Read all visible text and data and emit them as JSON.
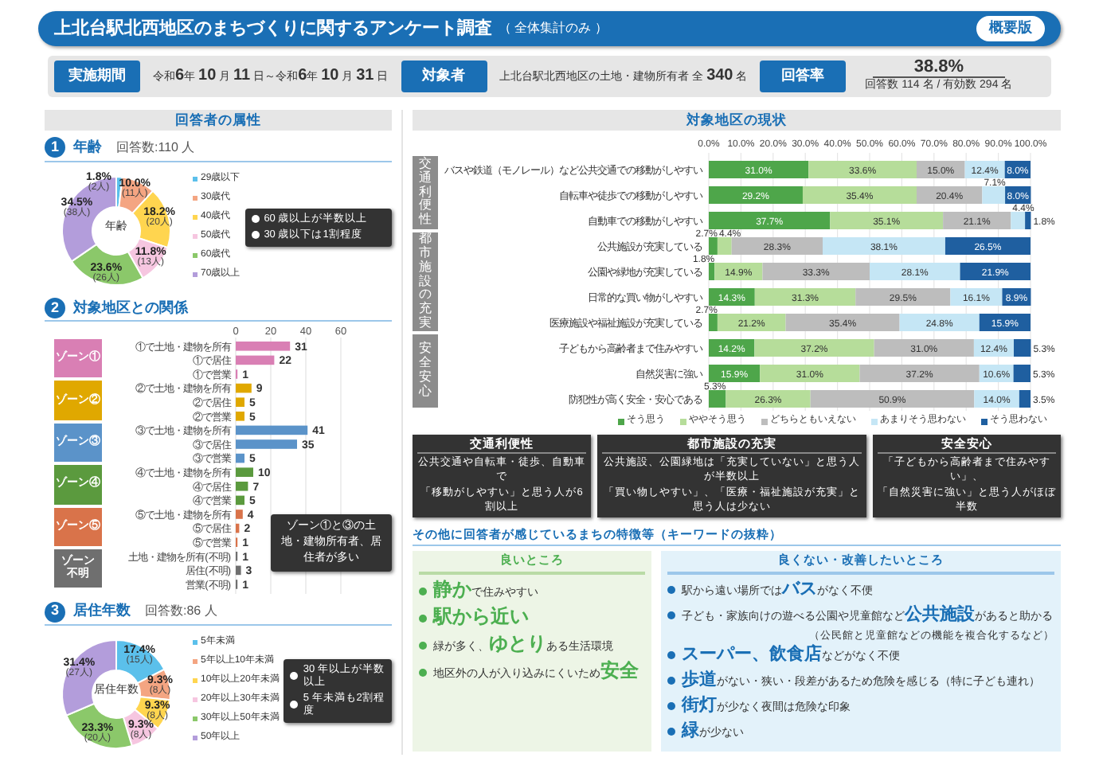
{
  "header": {
    "title": "上北台駅北西地区のまちづくりに関するアンケート調査",
    "subtitle": "（ 全体集計のみ ）",
    "badge": "概要版"
  },
  "info": {
    "period_label": "実施期間",
    "period": "令和**6**年 **10** 月 **11** 日～令和**6**年 **10** 月 **31** 日",
    "target_label": "対象者",
    "target": "上北台駅北西地区の土地・建物所有者 全 **340** 名",
    "rate_label": "回答率",
    "rate": "38.8%",
    "rate_detail": "回答数 114 名 / 有効数 294 名"
  },
  "attributes": {
    "title": "回答者の属性",
    "age": {
      "number": "1",
      "title": "年齢",
      "count": "回答数:110 人",
      "center": "年齢",
      "notes": [
        "60 歳以上が半数以上",
        "30 歳以下は1割程度"
      ],
      "chart_data": {
        "type": "donut",
        "categories": [
          "29歳以下",
          "30歳代",
          "40歳代",
          "50歳代",
          "60歳代",
          "70歳以上"
        ],
        "values": [
          1.8,
          10.0,
          18.2,
          11.8,
          23.6,
          34.5
        ],
        "value_labels": [
          "1.8%",
          "10.0%",
          "18.2%",
          "11.8%",
          "23.6%",
          "34.5%"
        ],
        "annotations": [
          "(2人)",
          "(11人)",
          "(20人)",
          "(13人)",
          "(26人)",
          "(38人)"
        ],
        "colors": [
          "#5bc0eb",
          "#f4a582",
          "#ffd54f",
          "#f6c6e0",
          "#8bc86a",
          "#b39ddb"
        ]
      }
    },
    "relation": {
      "number": "2",
      "title": "対象地区との関係",
      "note": "ゾーン①と③の土地・建物所有者、居住者が多い",
      "zones": [
        {
          "lines": [
            "ゾーン①"
          ],
          "color": "#d97fb4"
        },
        {
          "lines": [
            "ゾーン②"
          ],
          "color": "#e0a800"
        },
        {
          "lines": [
            "ゾーン③"
          ],
          "color": "#5b93c9"
        },
        {
          "lines": [
            "ゾーン④"
          ],
          "color": "#5b9a3e"
        },
        {
          "lines": [
            "ゾーン⑤"
          ],
          "color": "#d9734a"
        },
        {
          "lines": [
            "ゾーン",
            "不明"
          ],
          "color": "#6f6f6f"
        }
      ],
      "chart_data": {
        "type": "bar",
        "orientation": "horizontal",
        "xlim": [
          0,
          60
        ],
        "xticks": [
          0,
          20,
          40,
          60
        ],
        "grid": true,
        "data_labels": true,
        "categories": [
          "①で土地・建物を所有",
          "①で居住",
          "①で営業",
          "②で土地・建物を所有",
          "②で居住",
          "②で営業",
          "③で土地・建物を所有",
          "③で居住",
          "③で営業",
          "④で土地・建物を所有",
          "④で居住",
          "④で営業",
          "⑤で土地・建物を所有",
          "⑤で居住",
          "⑤で営業",
          "土地・建物を所有(不明)",
          "居住(不明)",
          "営業(不明)"
        ],
        "values": [
          31,
          22,
          1,
          9,
          5,
          5,
          41,
          35,
          5,
          10,
          7,
          5,
          4,
          2,
          1,
          1,
          3,
          1
        ]
      }
    },
    "residence": {
      "number": "3",
      "title": "居住年数",
      "count": "回答数:86 人",
      "center": "居住年数",
      "notes": [
        "30 年以上が半数以上",
        "5 年未満も2割程度"
      ],
      "chart_data": {
        "type": "donut",
        "categories": [
          "5年未満",
          "5年以上10年未満",
          "10年以上20年未満",
          "20年以上30年未満",
          "30年以上50年未満",
          "50年以上"
        ],
        "values": [
          17.4,
          9.3,
          9.3,
          9.3,
          23.3,
          31.4
        ],
        "value_labels": [
          "17.4%",
          "9.3%",
          "9.3%",
          "9.3%",
          "23.3%",
          "31.4%"
        ],
        "annotations": [
          "(15人)",
          "(8人)",
          "(8人)",
          "(8人)",
          "(20人)",
          "(27人)"
        ],
        "colors": [
          "#5bc0eb",
          "#f4a582",
          "#ffd54f",
          "#f6c6e0",
          "#8bc86a",
          "#b39ddb"
        ]
      }
    }
  },
  "status": {
    "title": "対象地区の現状",
    "groups": [
      {
        "label": "交通利便性",
        "categories": [
          "バスや鉄道（モノレール）など公共交通での移動がしやすい",
          "自転車や徒歩での移動がしやすい",
          "自動車での移動がしやすい"
        ]
      },
      {
        "label": "都市施設の充実",
        "categories": [
          "公共施設が充実している",
          "公園や緑地が充実している",
          "日常的な買い物がしやすい",
          "医療施設や福祉施設が充実している"
        ]
      },
      {
        "label": "安全安心",
        "categories": [
          "子どもから高齢者まで住みやすい",
          "自然災害に強い",
          "防犯性が高く安全・安心である"
        ]
      }
    ],
    "chart_data": {
      "type": "bar",
      "orientation": "horizontal",
      "stacked": true,
      "grid": true,
      "xlim": [
        0,
        100
      ],
      "xticks": [
        {
          "value": 0,
          "label": "0.0%"
        },
        {
          "value": 10,
          "label": "10.0%"
        },
        {
          "value": 20,
          "label": "20.0%"
        },
        {
          "value": 30,
          "label": "30.0%"
        },
        {
          "value": 40,
          "label": "40.0%"
        },
        {
          "value": 50,
          "label": "50.0%"
        },
        {
          "value": 60,
          "label": "60.0%"
        },
        {
          "value": 70,
          "label": "70.0%"
        },
        {
          "value": 80,
          "label": "80.0%"
        },
        {
          "value": 90,
          "label": "90.0%"
        },
        {
          "value": 100,
          "label": "100.0%"
        }
      ],
      "series": [
        {
          "name": "そう思う",
          "color": "#4ea64a",
          "values": [
            31.0,
            29.2,
            37.7,
            2.7,
            1.8,
            14.3,
            2.7,
            14.2,
            15.9,
            5.3
          ]
        },
        {
          "name": "ややそう思う",
          "color": "#b6dd9a",
          "values": [
            33.6,
            35.4,
            35.1,
            4.4,
            14.9,
            31.3,
            21.2,
            37.2,
            31.0,
            26.3
          ]
        },
        {
          "name": "どちらともいえない",
          "color": "#bdbdbd",
          "values": [
            15.0,
            20.4,
            21.1,
            28.3,
            33.3,
            29.5,
            35.4,
            31.0,
            37.2,
            50.9
          ]
        },
        {
          "name": "あまりそう思わない",
          "color": "#c5e6f5",
          "values": [
            12.4,
            7.1,
            4.4,
            38.1,
            28.1,
            16.1,
            24.8,
            12.4,
            10.6,
            14.0
          ]
        },
        {
          "name": "そう思わない",
          "color": "#1f5fa0",
          "values": [
            8.0,
            8.0,
            1.8,
            26.5,
            21.9,
            8.9,
            15.9,
            5.3,
            5.3,
            3.5
          ]
        }
      ],
      "value_labels": [
        [
          "31.0%",
          "29.2%",
          "37.7%",
          "2.7%",
          "1.8%",
          "14.3%",
          "2.7%",
          "14.2%",
          "15.9%",
          "5.3%"
        ],
        [
          "33.6%",
          "35.4%",
          "35.1%",
          "4.4%",
          "14.9%",
          "31.3%",
          "21.2%",
          "37.2%",
          "31.0%",
          "26.3%"
        ],
        [
          "15.0%",
          "20.4%",
          "21.1%",
          "28.3%",
          "33.3%",
          "29.5%",
          "35.4%",
          "31.0%",
          "37.2%",
          "50.9%"
        ],
        [
          "12.4%",
          "7.1%",
          "4.4%",
          "38.1%",
          "28.1%",
          "16.1%",
          "24.8%",
          "12.4%",
          "10.6%",
          "14.0%"
        ],
        [
          "8.0%",
          "8.0%",
          "1.8%",
          "26.5%",
          "21.9%",
          "8.9%",
          "15.9%",
          "5.3%",
          "5.3%",
          "3.5%"
        ]
      ]
    },
    "summaries": [
      {
        "title": "交通利便性",
        "lines": [
          "公共交通や自転車・徒歩、自動車で",
          "「移動がしやすい」と思う人が6割以上"
        ]
      },
      {
        "title": "都市施設の充実",
        "lines": [
          "公共施設、公園緑地は「充実していない」と思う人が半数以上",
          "「買い物しやすい」、「医療・福祉施設が充実」と思う人は少ない"
        ]
      },
      {
        "title": "安全安心",
        "lines": [
          "「子どもから高齢者まで住みやすい」、",
          "「自然災害に強い」と思う人がほぼ半数"
        ]
      }
    ]
  },
  "keywords": {
    "title": "その他に回答者が感じているまちの特徴等（キーワードの抜粋）",
    "good": {
      "title": "良いところ",
      "items": [
        {
          "text": "**静か**で住みやすい"
        },
        {
          "text": "**駅から近い**"
        },
        {
          "text": "緑が多く、**ゆとり**ある生活環境"
        },
        {
          "text": "地区外の人が入り込みにくいため**安全**"
        }
      ]
    },
    "bad": {
      "title": "良くない・改善したいところ",
      "items": [
        {
          "text": "駅から遠い場所では**バス**がなく不便"
        },
        {
          "text": "子ども・家族向けの遊べる公園や児童館など**公共施設**があると助かる",
          "note": "（公民館と児童館などの機能を複合化するなど）"
        },
        {
          "text": "**スーパー、飲食店**などがなく不便"
        },
        {
          "text": "**歩道**がない・狭い・段差があるため危険を感じる（特に子ども連れ）"
        },
        {
          "text": "**街灯**が少なく夜間は危険な印象"
        },
        {
          "text": "**緑**が少ない"
        }
      ]
    }
  }
}
